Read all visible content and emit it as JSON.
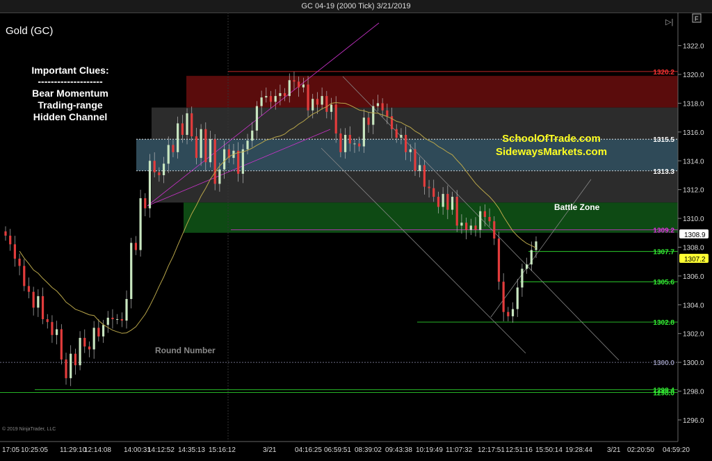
{
  "window_title": "GC 04-19 (2000 Tick)  3/21/2019",
  "instrument": "Gold (GC)",
  "copyright": "© 2019 NinjaTrader, LLC",
  "clues": {
    "title": "Important Clues:",
    "divider": "--------------------",
    "items": [
      "Bear Momentum",
      "Trading-range",
      "Hidden Channel"
    ]
  },
  "promo": [
    "SchoolOfTrade.com",
    "SidewaysMarkets.com"
  ],
  "annotations": {
    "battle_zone": "Battle Zone",
    "round_number": "Round Number"
  },
  "buttons": {
    "f": "F",
    "play": "▷|"
  },
  "colors": {
    "up": "#c8e6c0",
    "down": "#e23c3c",
    "ma": "#b9a64a",
    "channel": "#cc33cc"
  },
  "chart_data": {
    "type": "candlestick",
    "ylim": [
      1294.5,
      1324.3
    ],
    "bars": 177,
    "y_ticks": [
      "1296.0",
      "1298.0",
      "1300.0",
      "1302.0",
      "1304.0",
      "1306.0",
      "1308.0",
      "1310.0",
      "1312.0",
      "1314.0",
      "1316.0",
      "1318.0",
      "1320.0",
      "1322.0"
    ],
    "x_labels": [
      "17:05",
      "10:25:05",
      "11:29:10",
      "12:14:08",
      "14:00:31",
      "14:12:52",
      "14:35:13",
      "15:16:12",
      "3/21",
      "04:16:25",
      "06:59:51",
      "08:39:02",
      "09:43:38",
      "10:19:49",
      "11:07:32",
      "12:17:51",
      "12:51:16",
      "15:50:14",
      "19:28:44",
      "3/21",
      "02:20:50",
      "04:59:20"
    ],
    "zones": [
      {
        "name": "red-zone",
        "from": 1317.7,
        "to": 1319.9,
        "color": "#5a0c0c"
      },
      {
        "name": "upper-gray-zone",
        "from": 1315.5,
        "to": 1317.7,
        "color": "#2c2c2c"
      },
      {
        "name": "blue-zone",
        "from": 1313.3,
        "to": 1315.5,
        "color": "#2f4a58"
      },
      {
        "name": "lower-gray-zone",
        "from": 1311.1,
        "to": 1313.3,
        "color": "#2c2c2c"
      },
      {
        "name": "green-zone",
        "from": 1309.0,
        "to": 1311.1,
        "color": "#0e4a14"
      }
    ],
    "levels": [
      {
        "label": "1320.2",
        "value": 1320.2,
        "color": "#ff3333"
      },
      {
        "label": "1315.5",
        "value": 1315.5,
        "color": "#ffffff"
      },
      {
        "label": "1313.3",
        "value": 1313.3,
        "color": "#ffffff"
      },
      {
        "label": "1309.2",
        "value": 1309.2,
        "color": "#dd33dd"
      },
      {
        "label": "1307.7",
        "value": 1307.7,
        "color": "#33ee33"
      },
      {
        "label": "1305.6",
        "value": 1305.6,
        "color": "#33ee33"
      },
      {
        "label": "1302.8",
        "value": 1302.8,
        "color": "#33ee33"
      },
      {
        "label": "1300.0",
        "value": 1300.0,
        "color": "#9090b0"
      },
      {
        "label": "1298.4",
        "value": 1298.1,
        "color": "#33ee33"
      },
      {
        "label": "1298.0",
        "value": 1297.9,
        "color": "#33ee33"
      }
    ],
    "price_tags": [
      {
        "label": "1308.9",
        "value": 1308.9,
        "bg": "#ffffff",
        "fg": "#000000"
      },
      {
        "label": "1307.2",
        "value": 1307.2,
        "bg": "#ffff33",
        "fg": "#000000"
      }
    ],
    "closes": [
      1308.8,
      1308.2,
      1307.2,
      1306.7,
      1305.3,
      1304.9,
      1303.8,
      1304.6,
      1303.0,
      1302.8,
      1301.9,
      1302.3,
      1300.2,
      1298.9,
      1300.6,
      1299.8,
      1301.7,
      1301.1,
      1300.9,
      1302.4,
      1301.8,
      1302.6,
      1303.1,
      1303.0,
      1303.0,
      1302.9,
      1304.4,
      1308.3,
      1307.8,
      1311.4,
      1310.7,
      1314.0,
      1313.2,
      1313.0,
      1313.8,
      1315.1,
      1314.6,
      1316.6,
      1315.8,
      1317.3,
      1315.7,
      1314.2,
      1316.2,
      1313.9,
      1315.5,
      1312.4,
      1313.4,
      1314.8,
      1314.2,
      1314.7,
      1313.1,
      1314.8,
      1315.4,
      1316.1,
      1317.8,
      1318.4,
      1318.5,
      1318.1,
      1318.5,
      1318.7,
      1318.5,
      1319.6,
      1319.5,
      1319.1,
      1319.3,
      1317.5,
      1318.3,
      1317.9,
      1318.5,
      1317.4,
      1317.9,
      1315.9,
      1314.6,
      1315.8,
      1315.2,
      1315.2,
      1315.0,
      1317.0,
      1316.5,
      1317.8,
      1318.0,
      1317.5,
      1317.1,
      1316.2,
      1315.6,
      1315.8,
      1314.6,
      1314.8,
      1313.3,
      1313.7,
      1312.2,
      1312.1,
      1311.5,
      1310.8,
      1311.7,
      1310.6,
      1311.5,
      1309.5,
      1309.7,
      1309.2,
      1309.5,
      1309.2,
      1310.5,
      1310.1,
      1309.8,
      1308.6,
      1305.6,
      1303.5,
      1303.2,
      1303.7,
      1305.2,
      1306.5,
      1306.8,
      1307.8,
      1308.4
    ],
    "moving_average": "20-bar"
  }
}
